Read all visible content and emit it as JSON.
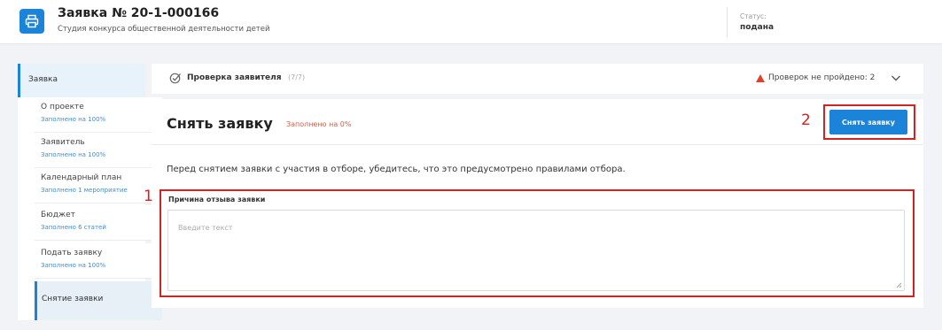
{
  "header": {
    "title": "Заявка № 20-1-000166",
    "subtitle": "Студия конкурса общественной деятельности детей",
    "status_label": "Статус:",
    "status_value": "подана"
  },
  "sidebar": {
    "header": "Заявка",
    "items": [
      {
        "label": "О проекте",
        "sub": "Заполнено на 100%"
      },
      {
        "label": "Заявитель",
        "sub": "Заполнено на 100%"
      },
      {
        "label": "Календарный план",
        "sub": "Заполнено 1 мероприятие"
      },
      {
        "label": "Бюджет",
        "sub": "Заполнено 6 статей"
      },
      {
        "label": "Подать заявку",
        "sub": "Заполнено на 100%"
      },
      {
        "label": "Снятие заявки",
        "sub": ""
      }
    ]
  },
  "check": {
    "title": "Проверка заявителя",
    "count": "(7/7)",
    "warning": "Проверок не пройдено: 2"
  },
  "main": {
    "title": "Снять заявку",
    "filled": "Заполнено на 0%",
    "button": "Снять заявку",
    "info": "Перед снятием заявки с участия в отборе, убедитесь, что это предусмотрено правилами отбора.",
    "field_label": "Причина отзыва заявки",
    "field_placeholder": "Введите текст"
  },
  "annotations": {
    "marker_1": "1",
    "marker_2": "2"
  },
  "colors": {
    "accent": "#1b84d8",
    "highlight": "#d32222",
    "warning": "#e05a3c"
  }
}
